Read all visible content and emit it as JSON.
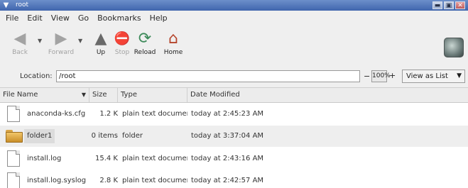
{
  "window": {
    "title": "root",
    "menu_glyph": "▼",
    "buttons": [
      "▬",
      "▣",
      "✕"
    ]
  },
  "menubar": [
    "File",
    "Edit",
    "View",
    "Go",
    "Bookmarks",
    "Help"
  ],
  "toolbar": {
    "back": {
      "label": "Back",
      "icon": "back-arrow-icon",
      "glyph": "◀"
    },
    "forward": {
      "label": "Forward",
      "icon": "forward-arrow-icon",
      "glyph": "▶"
    },
    "up": {
      "label": "Up",
      "icon": "up-arrow-icon",
      "glyph": "▲"
    },
    "stop": {
      "label": "Stop",
      "icon": "stop-icon",
      "glyph": "⛔"
    },
    "reload": {
      "label": "Reload",
      "icon": "reload-icon",
      "glyph": "⟳"
    },
    "home": {
      "label": "Home",
      "icon": "home-icon",
      "glyph": "⌂"
    },
    "dropdown_glyph": "▼"
  },
  "location": {
    "label": "Location:",
    "value": "/root",
    "zoom_out": "−",
    "zoom": "100%",
    "zoom_in": "+",
    "view_mode": "View as List",
    "view_arrow": "▼"
  },
  "columns": {
    "name": "File Name",
    "sort_glyph": "▼",
    "size": "Size",
    "type": "Type",
    "date": "Date Modified"
  },
  "files": [
    {
      "name": "anaconda-ks.cfg",
      "size": "1.2 K",
      "type": "plain text document",
      "date": "today at 2:45:23 AM",
      "icon": "text-file-icon"
    },
    {
      "name": "folder1",
      "size": "0 items",
      "type": "folder",
      "date": "today at 3:37:04 AM",
      "icon": "folder-icon"
    },
    {
      "name": "install.log",
      "size": "15.4 K",
      "type": "plain text document",
      "date": "today at 2:43:16 AM",
      "icon": "text-file-icon"
    },
    {
      "name": "install.log.syslog",
      "size": "2.8 K",
      "type": "plain text document",
      "date": "today at 2:42:57 AM",
      "icon": "text-file-icon"
    }
  ],
  "colors": {
    "titlebar": "#4b72b8",
    "chrome": "#efefef",
    "home_roof": "#b5442b",
    "folder": "#e9b450"
  }
}
